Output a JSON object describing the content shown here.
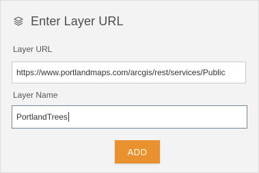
{
  "header": {
    "icon": "layers-icon",
    "title": "Enter Layer URL"
  },
  "form": {
    "url_label": "Layer URL",
    "url_value": "https://www.portlandmaps.com/arcgis/rest/services/Public",
    "name_label": "Layer Name",
    "name_value": "PortlandTrees",
    "add_label": "ADD"
  },
  "colors": {
    "panel_bg": "#f3f3f3",
    "accent": "#e8912e",
    "focus_border": "#6d86a8"
  }
}
